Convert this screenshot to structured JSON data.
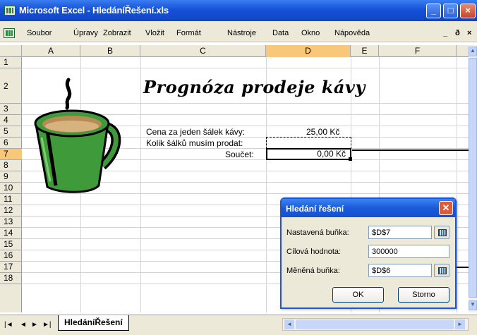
{
  "window": {
    "title": "Microsoft Excel - HledáníŘešení.xls"
  },
  "menu": [
    "Soubor",
    "Úpravy",
    "Zobrazit",
    "Vložit",
    "Formát",
    "Nástroje",
    "Data",
    "Okno",
    "Nápověda"
  ],
  "columns": [
    "A",
    "B",
    "C",
    "D",
    "E",
    "F"
  ],
  "rows": [
    "1",
    "2",
    "3",
    "4",
    "5",
    "6",
    "7",
    "8",
    "9",
    "10",
    "11",
    "12",
    "13",
    "14",
    "15",
    "16",
    "17",
    "18"
  ],
  "cells": {
    "title": "Prognóza prodeje kávy",
    "c5": "Cena za jeden šálek kávy:",
    "d5": "25,00 Kč",
    "c6": "Kolik šálků musím prodat:",
    "c7": "Součet:",
    "d7": "0,00 Kč"
  },
  "sheet_tab": "HledáníŘešení",
  "dialog": {
    "title": "Hledání řešení",
    "set_cell_label": "Nastavená buňka:",
    "set_cell_value": "$D$7",
    "to_value_label": "Cílová hodnota:",
    "to_value_value": "300000",
    "changing_cell_label": "Měněná buňka:",
    "changing_cell_value": "$D$6",
    "ok_label": "OK",
    "cancel_label": "Storno"
  },
  "colors": {
    "title_bar": "#1552d8",
    "selected_header": "#f9c779",
    "mug_green": "#3f9a3a"
  }
}
